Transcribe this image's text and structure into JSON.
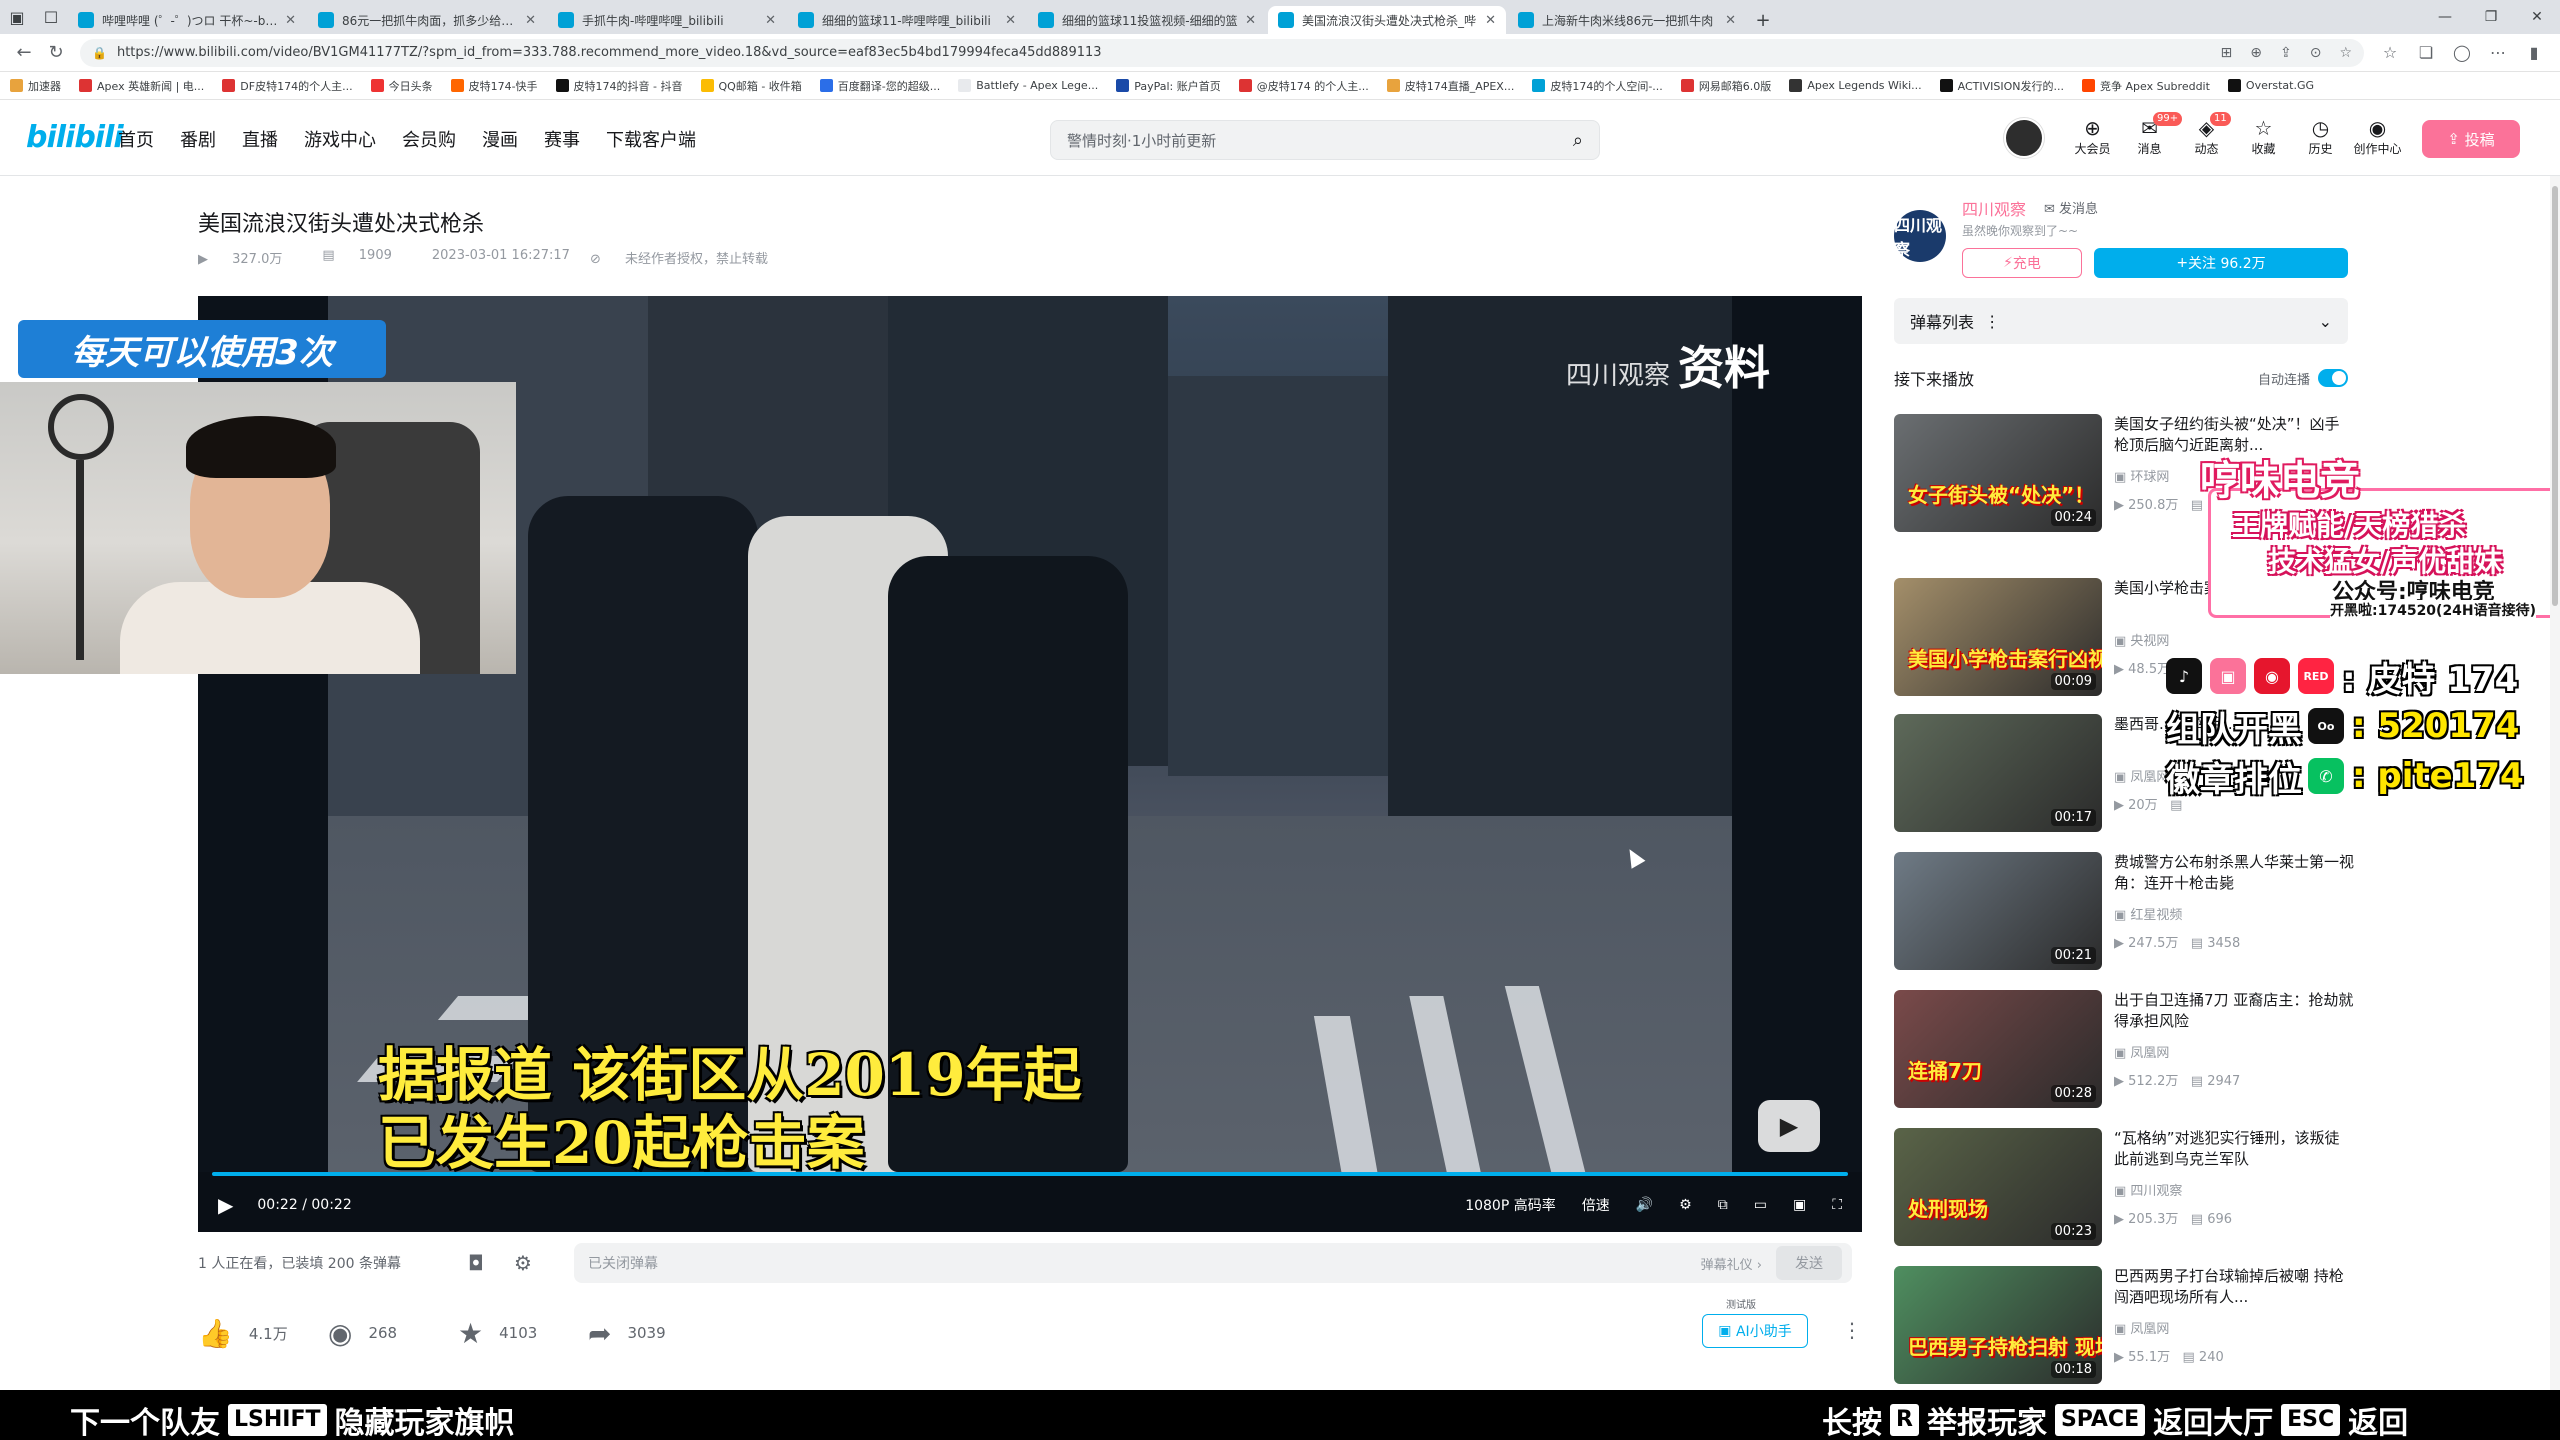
{
  "browser": {
    "tabs": [
      {
        "title": "哔哩哔哩 (゜-゜)つロ 干杯~-bilibili"
      },
      {
        "title": "86元一把抓牛肉面，抓多少给多少"
      },
      {
        "title": "手抓牛肉-哔哩哔哩_bilibili"
      },
      {
        "title": "细细的篮球11-哔哩哔哩_bilibili"
      },
      {
        "title": "细细的篮球11投篮视频-细细的篮"
      },
      {
        "title": "美国流浪汉街头遭处决式枪杀_哔"
      },
      {
        "title": "上海新牛肉米线86元一把抓牛肉"
      }
    ],
    "url": "https://www.bilibili.com/video/BV1GM41177TZ/?spm_id_from=333.788.recommend_more_video.18&vd_source=eaf83ec5b4bd179994feca45dd889113",
    "bookmarks": [
      {
        "label": "加速器",
        "color": "#e8a33d"
      },
      {
        "label": "Apex 英雄新闻 | 电...",
        "color": "#d33"
      },
      {
        "label": "DF皮特174的个人主...",
        "color": "#d33"
      },
      {
        "label": "今日头条",
        "color": "#e33"
      },
      {
        "label": "皮特174-快手",
        "color": "#f60"
      },
      {
        "label": "皮特174的抖音 - 抖音",
        "color": "#111"
      },
      {
        "label": "QQ邮箱 - 收件箱",
        "color": "#fbbc04"
      },
      {
        "label": "百度翻译-您的超级...",
        "color": "#2b6ee8"
      },
      {
        "label": "Battlefy - Apex Lege...",
        "color": "#e8eaed"
      },
      {
        "label": "PayPal: 账户首页",
        "color": "#1a4aa8"
      },
      {
        "label": "@皮特174 的个人主...",
        "color": "#d33"
      },
      {
        "label": "皮特174直播_APEX...",
        "color": "#e8a33d"
      },
      {
        "label": "皮特174的个人空间-...",
        "color": "#00a1d6"
      },
      {
        "label": "网易邮箱6.0版",
        "color": "#d33"
      },
      {
        "label": "Apex Legends Wiki...",
        "color": "#333"
      },
      {
        "label": "ACTIVISION发行的...",
        "color": "#111"
      },
      {
        "label": "竞争 Apex Subreddit",
        "color": "#ff4500"
      },
      {
        "label": "Overstat.GG",
        "color": "#111"
      }
    ]
  },
  "header": {
    "logo": "bilibili",
    "nav": [
      "首页",
      "番剧",
      "直播",
      "游戏中心",
      "会员购",
      "漫画",
      "赛事",
      "下载客户端"
    ],
    "search_placeholder": "警情时刻·1小时前更新",
    "icons": [
      {
        "label": "大会员",
        "glyph": "⊕",
        "badge": ""
      },
      {
        "label": "消息",
        "glyph": "✉",
        "badge": "99+"
      },
      {
        "label": "动态",
        "glyph": "◈",
        "badge": "11"
      },
      {
        "label": "收藏",
        "glyph": "☆",
        "badge": ""
      },
      {
        "label": "历史",
        "glyph": "◷",
        "badge": ""
      },
      {
        "label": "创作中心",
        "glyph": "◉",
        "badge": ""
      }
    ],
    "upload": "投稿"
  },
  "video": {
    "title": "美国流浪汉街头遭处决式枪杀",
    "views": "327.0万",
    "danmaku_count": "1909",
    "date": "2023-03-01 16:27:17",
    "copyright": "未经作者授权，禁止转载",
    "watermark_brand": "四川观察",
    "watermark_tag": "资料",
    "subtitle_line1": "据报道 该街区从2019年起",
    "subtitle_line2": "已发生20起枪击案",
    "time_current": "00:22",
    "time_total": "00:22",
    "progress": 1.0,
    "quality": "1080P 高码率",
    "speed": "倍速"
  },
  "danmaku_bar": {
    "watching": "1 人正在看，已装填 200 条弹幕",
    "input_placeholder": "已关闭弹幕",
    "etiquette": "弹幕礼仪 ›",
    "send": "发送"
  },
  "toolbar": {
    "like": "4.1万",
    "coin": "268",
    "fav": "4103",
    "share": "3039",
    "ai_tag": "测试版",
    "ai_helper": "AI小助手"
  },
  "uploader": {
    "avatar_text": "四川观察",
    "name": "四川观察",
    "message": "发消息",
    "desc": "虽然晚你观察到了~~",
    "charge": "充电",
    "follow": "关注 96.2万"
  },
  "danmaku_list": {
    "label": "弹幕列表"
  },
  "next": {
    "label": "接下来播放",
    "autoplay": "自动连播"
  },
  "recommendations": [
    {
      "title": "美国女子纽约街头被“处决”！凶手枪顶后脑勺近距离射...",
      "author": "环球网",
      "views": "250.8万",
      "danmaku": "",
      "duration": "00:24",
      "caption": "女子街头被“处决”！",
      "thumb": "#6b6f72"
    },
    {
      "title": "美国小学枪击案行凶视频曝光!",
      "author": "央视网",
      "views": "48.5万",
      "danmaku": "",
      "duration": "00:09",
      "caption": "美国小学枪击案行凶视频曝光!",
      "thumb": "#a48f6a"
    },
    {
      "title": "墨西哥...员 挥手...",
      "author": "凤凰网",
      "views": "20万",
      "danmaku": "",
      "duration": "00:17",
      "caption": "",
      "thumb": "#5e6a5a"
    },
    {
      "title": "费城警方公布射杀黑人华莱士第一视角：连开十枪击毙",
      "author": "红星视频",
      "views": "247.5万",
      "danmaku": "3458",
      "duration": "00:21",
      "caption": "",
      "thumb": "#6f7b86"
    },
    {
      "title": "出于自卫连捅7刀 亚裔店主：抢劫就得承担风险",
      "author": "凤凰网",
      "views": "512.2万",
      "danmaku": "2947",
      "duration": "00:28",
      "caption": "连捅7刀",
      "thumb": "#7a4a4a"
    },
    {
      "title": "“瓦格纳”对逃犯实行锤刑，该叛徒此前逃到乌克兰军队",
      "author": "四川观察",
      "views": "205.3万",
      "danmaku": "696",
      "duration": "00:23",
      "caption": "处刑现场",
      "thumb": "#5a6448"
    },
    {
      "title": "巴西两男子打台球输掉后被嘲 持枪闯酒吧现场所有人...",
      "author": "凤凰网",
      "views": "55.1万",
      "danmaku": "240",
      "duration": "00:18",
      "caption": "巴西男子持枪扫射 现场8人7死",
      "thumb": "#4f8f60"
    }
  ],
  "overlay": {
    "webcam_banner": "每天可以使用3次",
    "promo_title": "哼味电竞",
    "promo_line1": "王牌赋能/天榜猎杀",
    "promo_line2": "技术猛女/声优甜妹",
    "promo_line3": "公众号:哼味电竞",
    "promo_phone": "开黑啦:174520(24H语音接待)",
    "social1": ": 皮特 174",
    "social2_label": "组队开黑",
    "social2_value": ": 520174",
    "social3_label": "徽章排位",
    "social3_value": ": pite174"
  },
  "game_hints": {
    "left1": "下一个队友",
    "left_key": "LSHIFT",
    "left2": "隐藏玩家旗帜",
    "right1": "长按",
    "right_key1": "R",
    "right2": "举报玩家",
    "right_key2": "SPACE",
    "right3": "返回大厅",
    "right_key3": "ESC",
    "right4": "返回"
  }
}
